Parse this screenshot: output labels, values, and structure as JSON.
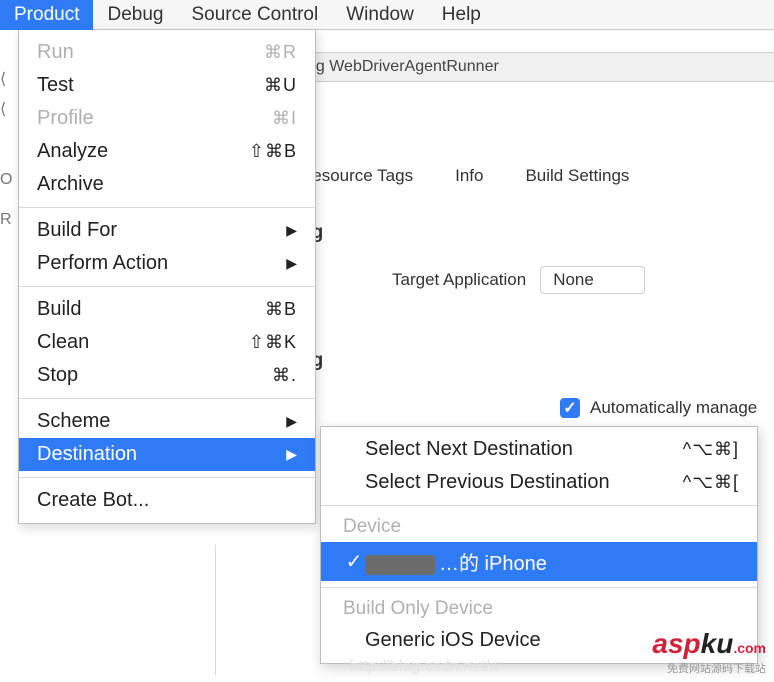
{
  "menubar": {
    "items": [
      "Product",
      "Debug",
      "Source Control",
      "Window",
      "Help"
    ],
    "selected_index": 0
  },
  "runner_bar": {
    "text": "ng WebDriverAgentRunner"
  },
  "tabs": {
    "resource_tags": "Resource Tags",
    "info": "Info",
    "build_settings": "Build Settings"
  },
  "sections": {
    "ng1": "ng",
    "ng2": "ng"
  },
  "target_app": {
    "label": "Target Application",
    "value": "None"
  },
  "signing": {
    "auto_label": "Automatically manage",
    "auto_checked": true
  },
  "product_menu": {
    "run": {
      "label": "Run",
      "shortcut": "⌘R",
      "disabled": true
    },
    "test": {
      "label": "Test",
      "shortcut": "⌘U"
    },
    "profile": {
      "label": "Profile",
      "shortcut": "⌘I",
      "disabled": true
    },
    "analyze": {
      "label": "Analyze",
      "shortcut": "⇧⌘B"
    },
    "archive": {
      "label": "Archive"
    },
    "build_for": {
      "label": "Build For",
      "submenu": true
    },
    "perform": {
      "label": "Perform Action",
      "submenu": true
    },
    "build": {
      "label": "Build",
      "shortcut": "⌘B"
    },
    "clean": {
      "label": "Clean",
      "shortcut": "⇧⌘K"
    },
    "stop": {
      "label": "Stop",
      "shortcut": "⌘."
    },
    "scheme": {
      "label": "Scheme",
      "submenu": true
    },
    "destination": {
      "label": "Destination",
      "submenu": true,
      "highlight": true
    },
    "create_bot": {
      "label": "Create Bot..."
    }
  },
  "destination_submenu": {
    "next": {
      "label": "Select Next Destination",
      "shortcut": "^⌥⌘]"
    },
    "prev": {
      "label": "Select Previous Destination",
      "shortcut": "^⌥⌘["
    },
    "device_header": "Device",
    "device1": {
      "label_suffix": "…的 iPhone",
      "checked": true,
      "highlight": true
    },
    "buildonly_header": "Build Only Device",
    "generic": {
      "label": "Generic iOS Device"
    }
  },
  "watermark": {
    "brand_red1": "asp",
    "brand_black": "ku",
    "brand_com": ".com",
    "tagline": "免费网站源码下载站",
    "url": "http://blog.csdn.net/x"
  }
}
